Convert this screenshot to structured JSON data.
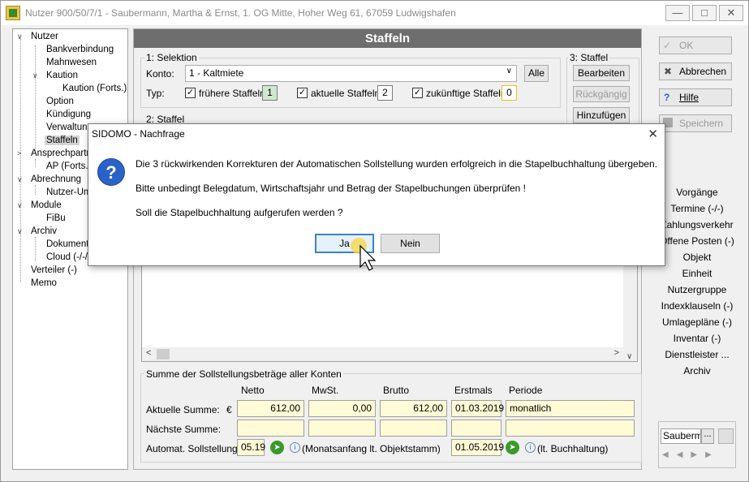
{
  "window": {
    "title": "Nutzer 900/50/7/1 - Saubermann, Martha & Ernst, 1. OG Mitte, Hoher Weg 61, 67059 Ludwigshafen",
    "minimize": "—",
    "maximize": "□",
    "close": "✕"
  },
  "tree": {
    "items": [
      {
        "label": "Nutzer"
      },
      {
        "label": "Bankverbindung"
      },
      {
        "label": "Mahnwesen"
      },
      {
        "label": "Kaution"
      },
      {
        "label": "Kaution (Forts.)"
      },
      {
        "label": "Option"
      },
      {
        "label": "Kündigung"
      },
      {
        "label": "Verwaltung"
      },
      {
        "label": "Staffeln"
      },
      {
        "label": "Ansprechpartn"
      },
      {
        "label": "AP (Forts.)"
      },
      {
        "label": "Abrechnung"
      },
      {
        "label": "Nutzer-Um"
      },
      {
        "label": "Module"
      },
      {
        "label": "FiBu"
      },
      {
        "label": "Archiv"
      },
      {
        "label": "Dokumente"
      },
      {
        "label": "Cloud (-/-/-"
      },
      {
        "label": "Verteiler (-)"
      },
      {
        "label": "Memo"
      }
    ]
  },
  "panel": {
    "title": "Staffeln",
    "selektion": {
      "label": "1: Selektion",
      "konto_label": "Konto:",
      "konto_value": "1 - Kaltmiete",
      "alle_button": "Alle",
      "typ_label": "Typ:",
      "fruehere": {
        "label": "frühere Staffeln:",
        "count": "1",
        "checked": "✓"
      },
      "aktuelle": {
        "label": "aktuelle Staffeln:",
        "count": "2",
        "checked": "✓"
      },
      "zukuenftige": {
        "label": "zukünftige Staffeln:",
        "count": "0",
        "checked": "✓"
      }
    },
    "staffel_actions": {
      "label": "3: Staffel",
      "bearbeiten": "Bearbeiten",
      "rueckgaengig": "Rückgängig",
      "hinzufuegen": "Hinzufügen"
    },
    "staffel_list": {
      "label": "2: Staffel"
    },
    "summary": {
      "label": "Summe der Sollstellungsbeträge aller Konten",
      "columns": [
        "Netto",
        "MwSt.",
        "Brutto",
        "Erstmals",
        "Periode"
      ],
      "aktuelle_label": "Aktuelle Summe:",
      "currency": "€",
      "aktuelle": {
        "netto": "612,00",
        "mwst": "0,00",
        "brutto": "612,00",
        "erstmals": "01.03.2019",
        "periode": "monatlich"
      },
      "naechste_label": "Nächste Summe:",
      "automat_label": "Automat. Sollstellung:",
      "automat_value": "05.19",
      "automat_note": "(Monatsanfang lt. Objektstamm)",
      "automat_date": "01.05.2019",
      "automat_note2": "(lt. Buchhaltung)"
    }
  },
  "right": {
    "ok": "OK",
    "abbrechen": "Abbrechen",
    "hilfe": "Hilfe",
    "speichern": "Speichern",
    "links": [
      "Vorgänge",
      "Termine (-/-)",
      "Zahlungsverkehr",
      "Offene Posten (-)",
      "Objekt",
      "Einheit",
      "Nutzergruppe",
      "Indexklauseln (-)",
      "Umlagepläne (-)",
      "Inventar (-)",
      "Dienstleister ...",
      "Archiv"
    ],
    "search_value": "Sauberm",
    "search_btn": "..."
  },
  "dialog": {
    "title": "SIDOMO - Nachfrage",
    "close": "✕",
    "line1": "Die 3 rückwirkenden Korrekturen der Automatischen Sollstellung wurden erfolgreich in die Stapelbuchhaltung übergeben.",
    "line2": "Bitte unbedingt Belegdatum, Wirtschaftsjahr und Betrag der Stapelbuchungen überprüfen !",
    "line3": "Soll die Stapelbuchhaltung aufgerufen werden ?",
    "yes": "Ja",
    "no": "Nein",
    "icon": "?"
  }
}
